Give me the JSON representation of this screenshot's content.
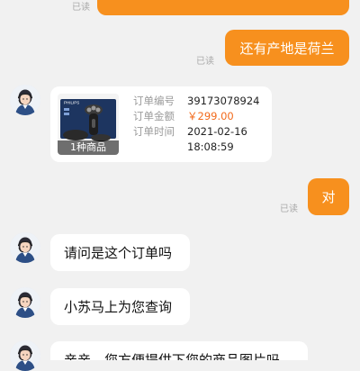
{
  "colors": {
    "background": "#f1f1f1",
    "outgoing_bubble": "#f7901e",
    "incoming_bubble": "#ffffff",
    "price": "#f26a1b",
    "receipt": "#a9a9a9"
  },
  "messages": {
    "top_receipt": "已读",
    "m1": {
      "text": "还有产地是荷兰",
      "receipt": "已读"
    },
    "order": {
      "thumb_caption": "1种商品",
      "brand": "PHILIPS",
      "number_label": "订单编号",
      "number_value": "39173078924",
      "amount_label": "订单金额",
      "amount_value": "￥299.00",
      "time_label": "订单时间",
      "time_date": "2021-02-16",
      "time_clock": "18:08:59"
    },
    "m2": {
      "text": "对",
      "receipt": "已读"
    },
    "m3": {
      "text": "请问是这个订单吗"
    },
    "m4": {
      "text": "小苏马上为您查询"
    },
    "m5": {
      "text": "亲亲，您方便提供下您的商品图片吗"
    }
  },
  "icons": {
    "avatar": "customer-service-agent-avatar"
  }
}
